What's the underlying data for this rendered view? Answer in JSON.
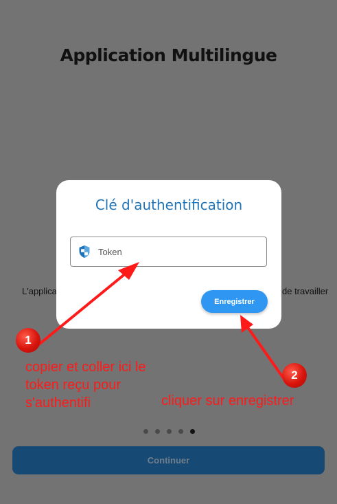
{
  "app": {
    "title": "Application Multilingue",
    "description_left": "L'applica",
    "description_right": "de travailler",
    "pager": {
      "total": 5,
      "active": 5
    },
    "continue_label": "Continuer"
  },
  "dialog": {
    "title": "Clé d'authentification",
    "token_field": {
      "placeholder": "Token",
      "value": "",
      "icon": "shield-icon"
    },
    "save_label": "Enregistrer"
  },
  "annotations": [
    {
      "number": "1",
      "text": "copier et coller ici le token reçu pour s'authentifi"
    },
    {
      "number": "2",
      "text": "cliquer sur enregistrer"
    }
  ],
  "colors": {
    "overlay_background": "#737373",
    "dialog_title": "#1f73b7",
    "save_button": "#2f97f2",
    "continue_button": "#164a75",
    "annotation_red": "#ff1a1a"
  }
}
